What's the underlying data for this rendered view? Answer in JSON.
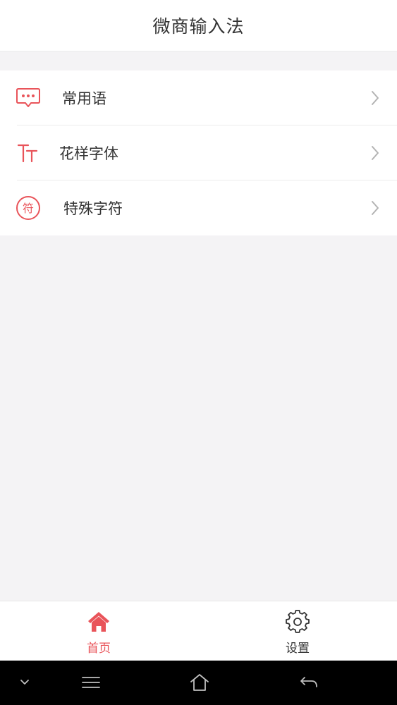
{
  "header": {
    "title": "微商输入法"
  },
  "menu": {
    "items": [
      {
        "label": "常用语",
        "icon": "chat-bubble-icon"
      },
      {
        "label": "花样字体",
        "icon": "font-tt-icon"
      },
      {
        "label": "特殊字符",
        "icon": "symbol-fu-icon",
        "icon_text": "符"
      }
    ]
  },
  "tabbar": {
    "tabs": [
      {
        "label": "首页",
        "icon": "home-icon",
        "active": true
      },
      {
        "label": "设置",
        "icon": "gear-icon",
        "active": false
      }
    ]
  },
  "colors": {
    "accent": "#e9545a",
    "text": "#333333",
    "chevron": "#b3b3b3",
    "background": "#f4f3f5"
  }
}
